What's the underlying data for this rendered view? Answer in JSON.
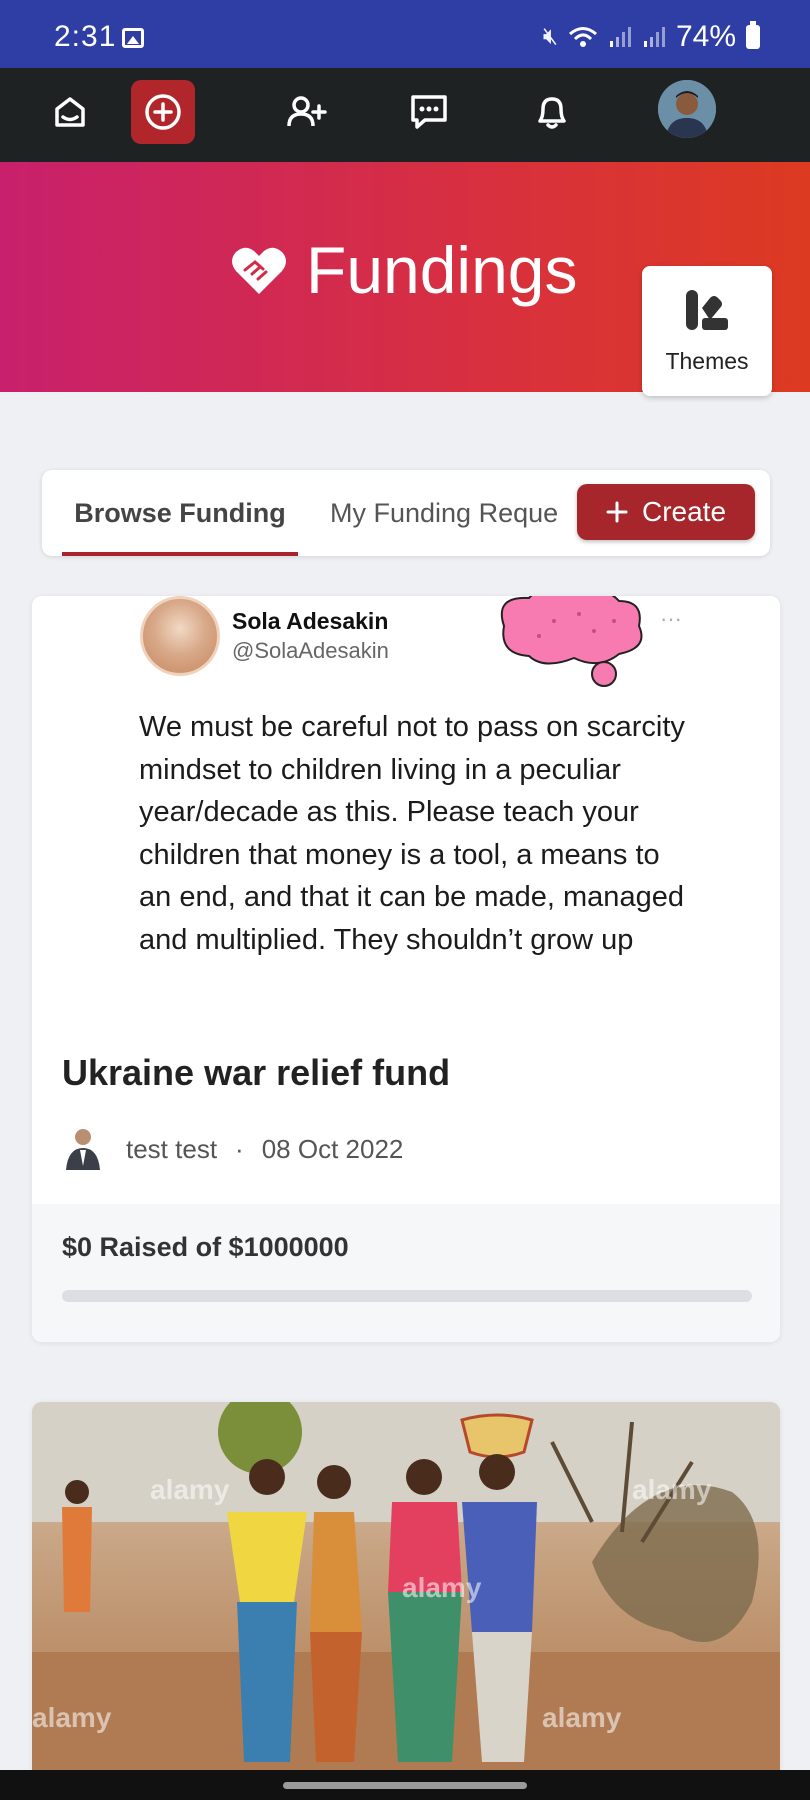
{
  "status_bar": {
    "time": "2:31",
    "battery": "74%",
    "icons": [
      "gallery-icon",
      "mute-icon",
      "wifi-icon",
      "signal-icon",
      "signal-icon",
      "battery-icon"
    ]
  },
  "top_nav": {
    "items": [
      "home-icon",
      "create-post-icon",
      "add-user-icon",
      "messages-icon",
      "bell-icon",
      "profile-avatar"
    ],
    "accent": "#b1262b"
  },
  "banner": {
    "title": "Fundings",
    "themes_label": "Themes",
    "gradient": [
      "#c8206c",
      "#dd3a22"
    ]
  },
  "tabs": {
    "browse_label": "Browse Funding",
    "mine_label": "My Funding Reque",
    "create_label": "Create"
  },
  "cards": [
    {
      "tweet": {
        "name": "Sola Adesakin",
        "handle": "@SolaAdesakin",
        "more": "···",
        "text": "We must be careful not to pass on scarcity mindset to children living in a peculiar year/decade as this. Please teach your children that money is a tool, a means to an end, and that it can be made, managed and multiplied. They shouldn’t grow up"
      },
      "title": "Ukraine war relief fund",
      "author": "test test",
      "separator": "·",
      "date": "08 Oct 2022",
      "raised_text": "$0 Raised of $1000000",
      "raised": 0,
      "goal": 1000000
    },
    {
      "watermark": "alamy"
    }
  ]
}
